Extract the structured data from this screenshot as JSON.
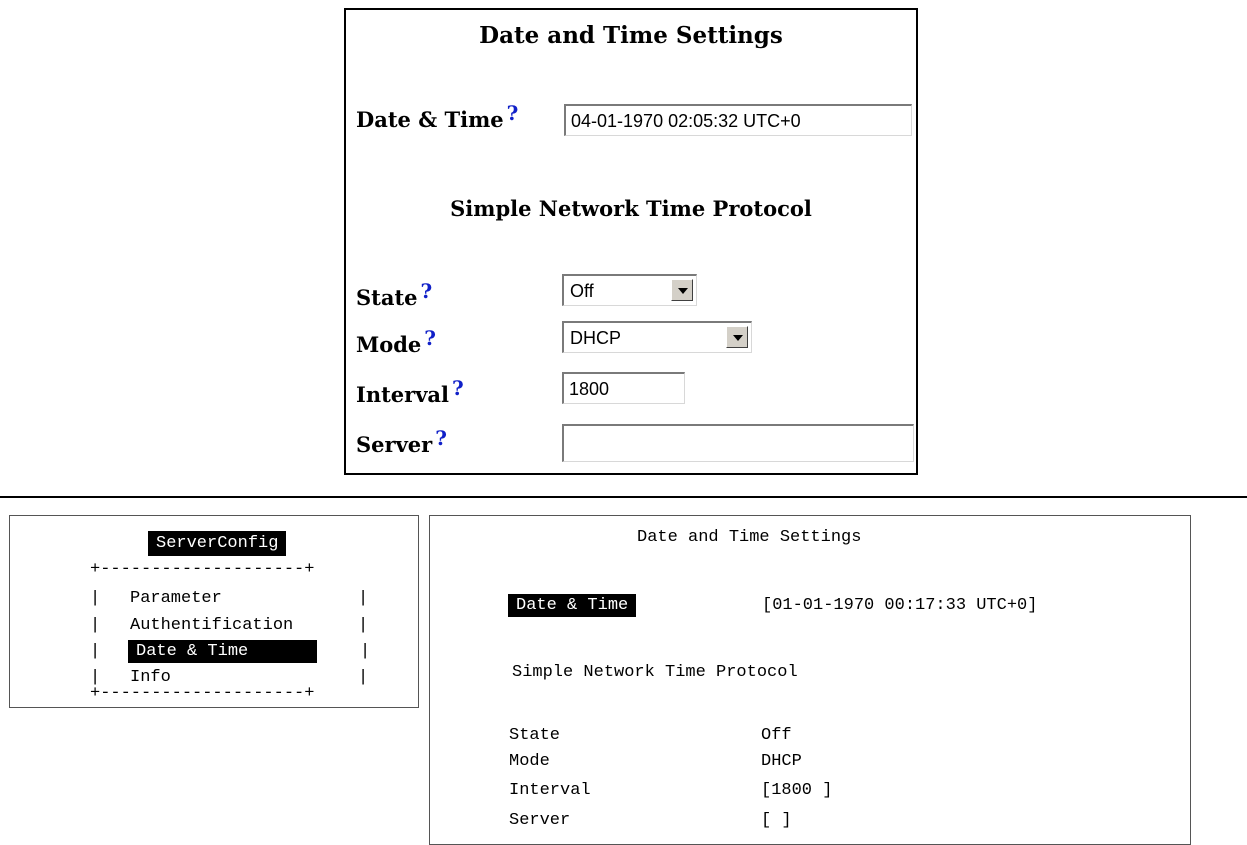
{
  "web": {
    "title": "Date and Time Settings",
    "datetime_label": "Date & Time",
    "datetime_value": "04-01-1970 02:05:32 UTC+0",
    "help_glyph": "?",
    "sntp_title": "Simple Network Time Protocol",
    "state_label": "State",
    "state_value": "Off",
    "mode_label": "Mode",
    "mode_value": "DHCP",
    "interval_label": "Interval",
    "interval_value": "1800",
    "server_label": "Server",
    "server_value": ""
  },
  "terminal": {
    "menu": {
      "title": "ServerConfig",
      "border_top": "+--------------------+",
      "border_bottom": "+--------------------+",
      "pipe": "|",
      "items": [
        {
          "label": "Parameter"
        },
        {
          "label": "Authentification"
        },
        {
          "label": "Date & Time"
        },
        {
          "label": "Info"
        }
      ],
      "selected_index": 2
    },
    "settings": {
      "title": "Date and Time Settings",
      "datetime_label": "Date & Time",
      "datetime_value": "[01-01-1970 00:17:33 UTC+0]",
      "sntp_title": "Simple Network Time Protocol",
      "state_label": "State",
      "state_value": "Off",
      "mode_label": "Mode",
      "mode_value": "DHCP",
      "interval_label": "Interval",
      "interval_value": "[1800 ]",
      "server_label": "Server",
      "server_value": "[ ]"
    }
  },
  "colors": {
    "help_icon": "#1020c8",
    "highlight_bg": "#000000",
    "highlight_fg": "#ffffff"
  }
}
